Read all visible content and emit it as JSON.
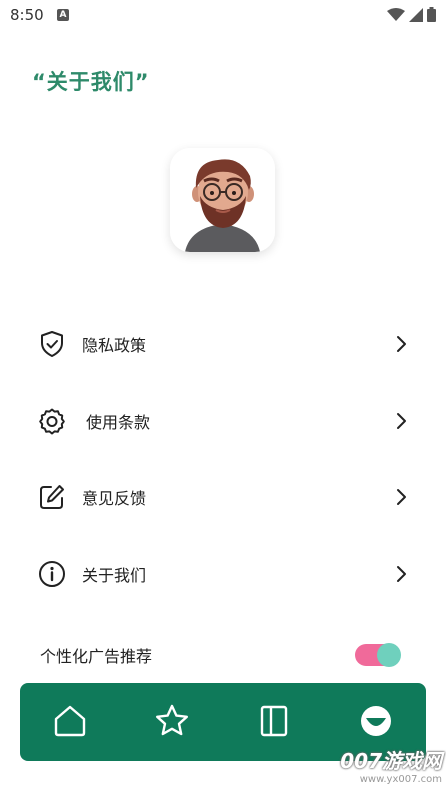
{
  "status_bar": {
    "time": "8:50",
    "a_icon": "A"
  },
  "header": {
    "title": "“关于我们”"
  },
  "avatar": {
    "description_icon": "avatar-icon"
  },
  "menu": {
    "items": [
      {
        "label": "隐私政策",
        "icon": "shield-check-icon"
      },
      {
        "label": "使用条款",
        "icon": "gear-icon"
      },
      {
        "label": "意见反馈",
        "icon": "edit-icon"
      },
      {
        "label": "关于我们",
        "icon": "info-icon"
      }
    ]
  },
  "ad_setting": {
    "label": "个性化广告推荐",
    "enabled": true
  },
  "bottom_nav": {
    "items": [
      {
        "icon": "home-icon"
      },
      {
        "icon": "star-icon"
      },
      {
        "icon": "book-icon"
      },
      {
        "icon": "profile-icon",
        "active": true
      }
    ]
  },
  "watermark": {
    "main": "007游戏网",
    "sub": "www.yx007.com"
  },
  "colors": {
    "accent": "#2e8a6a",
    "nav_background": "#0f7a5a",
    "toggle_track": "#f06a9a",
    "toggle_thumb": "#6fd0bd"
  }
}
